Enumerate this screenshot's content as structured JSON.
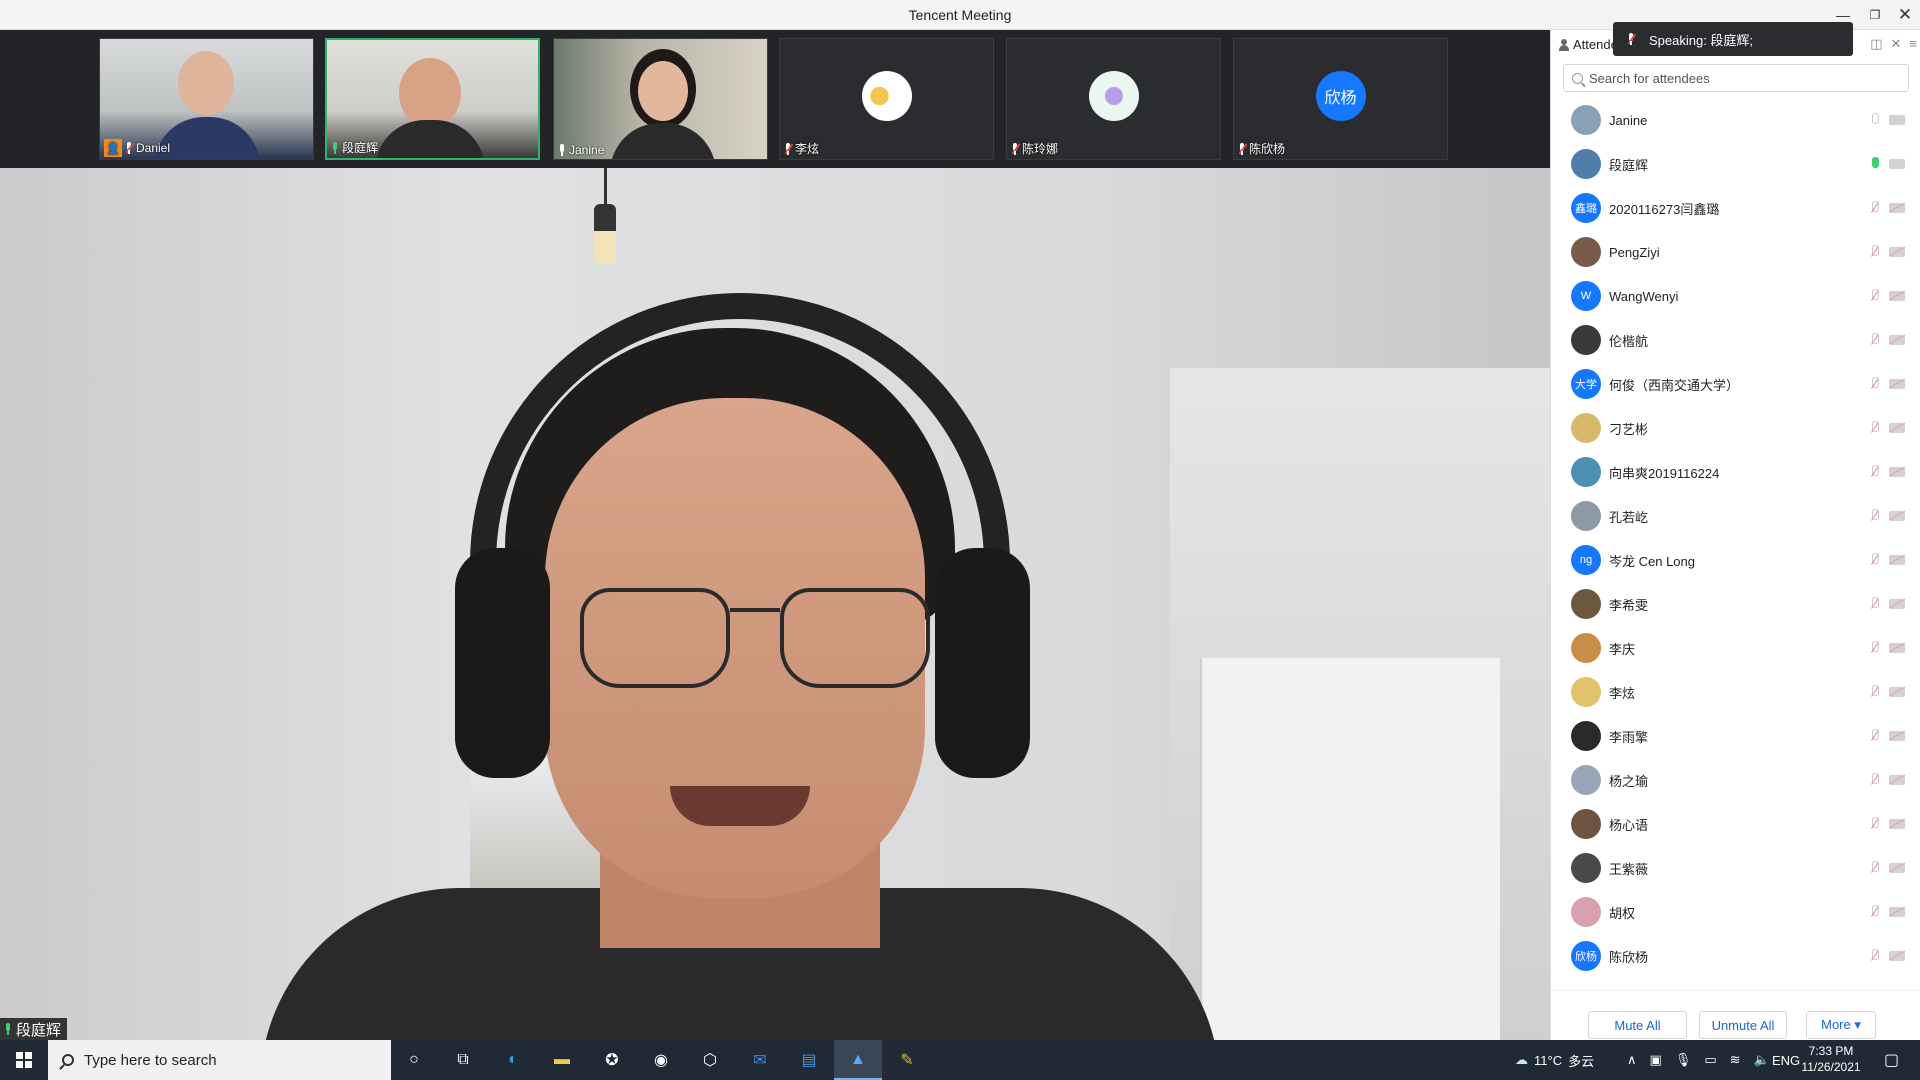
{
  "window": {
    "title": "Tencent Meeting"
  },
  "thumbnails": [
    {
      "name": "Daniel",
      "mic": "muted",
      "badge": "host"
    },
    {
      "name": "段庭辉",
      "mic": "on",
      "active": true
    },
    {
      "name": "Janine",
      "mic": "on"
    },
    {
      "name": "李炫",
      "mic": "muted",
      "avatar": "sticker"
    },
    {
      "name": "陈玲娜",
      "mic": "muted",
      "avatar": "sticker"
    },
    {
      "name": "陈欣杨",
      "mic": "muted",
      "avatar_text": "欣杨"
    }
  ],
  "main_video": {
    "speaker_label": "段庭辉"
  },
  "panel": {
    "tab_label": "Attendees",
    "speaking_toast": "Speaking: 段庭辉;",
    "search_placeholder": "Search for attendees",
    "attendees": [
      {
        "name": "Janine",
        "avatar": "photo",
        "color": "#8aa0b4",
        "mic": "idle",
        "cam": "idle"
      },
      {
        "name": "段庭辉",
        "avatar": "photo",
        "color": "#4f7fa8",
        "mic": "on",
        "cam": "idle"
      },
      {
        "name": "2020116273闫鑫璐",
        "avatar_text": "鑫璐",
        "color": "#1677ff",
        "mic": "off",
        "cam": "off"
      },
      {
        "name": "PengZiyi",
        "avatar": "photo",
        "color": "#7a5a48",
        "mic": "off",
        "cam": "off"
      },
      {
        "name": "WangWenyi",
        "avatar_text": "W",
        "color": "#1677ff",
        "mic": "off",
        "cam": "off"
      },
      {
        "name": "伦楷航",
        "avatar": "photo",
        "color": "#3a3a3a",
        "mic": "off",
        "cam": "off"
      },
      {
        "name": "何俊（西南交通大学）",
        "avatar_text": "大学",
        "color": "#1677ff",
        "mic": "off",
        "cam": "off"
      },
      {
        "name": "刁艺彬",
        "avatar": "photo",
        "color": "#d8b86a",
        "mic": "off",
        "cam": "off"
      },
      {
        "name": "向串爽2019116224",
        "avatar": "photo",
        "color": "#4c8fb0",
        "mic": "off",
        "cam": "off"
      },
      {
        "name": "孔若屹",
        "avatar": "photo",
        "color": "#8d99a6",
        "mic": "off",
        "cam": "off"
      },
      {
        "name": "岑龙 Cen Long",
        "avatar_text": "ng",
        "color": "#1677ff",
        "mic": "off",
        "cam": "off"
      },
      {
        "name": "李希雯",
        "avatar": "photo",
        "color": "#6b5a3e",
        "mic": "off",
        "cam": "off"
      },
      {
        "name": "李庆",
        "avatar": "photo",
        "color": "#c98d4a",
        "mic": "off",
        "cam": "off"
      },
      {
        "name": "李炫",
        "avatar": "photo",
        "color": "#e2c26a",
        "mic": "off",
        "cam": "off"
      },
      {
        "name": "李雨擎",
        "avatar": "photo",
        "color": "#2a2a2a",
        "mic": "off",
        "cam": "off"
      },
      {
        "name": "杨之瑜",
        "avatar": "photo",
        "color": "#9aa6b8",
        "mic": "off",
        "cam": "off"
      },
      {
        "name": "杨心语",
        "avatar": "photo",
        "color": "#6b5540",
        "mic": "off",
        "cam": "off"
      },
      {
        "name": "王紫薇",
        "avatar": "photo",
        "color": "#4a4a4a",
        "mic": "off",
        "cam": "off"
      },
      {
        "name": "胡权",
        "avatar": "photo",
        "color": "#d9a0b0",
        "mic": "off",
        "cam": "off"
      },
      {
        "name": "陈欣杨",
        "avatar_text": "欣杨",
        "color": "#1677ff",
        "mic": "off",
        "cam": "off"
      }
    ],
    "buttons": {
      "mute_all": "Mute All",
      "unmute_all": "Unmute All",
      "more": "More ▾"
    }
  },
  "taskbar": {
    "search_placeholder": "Type here to search",
    "weather": "11°C",
    "weather_text": "多云",
    "lang": "ENG",
    "time": "7:33 PM",
    "date": "11/26/2021"
  }
}
